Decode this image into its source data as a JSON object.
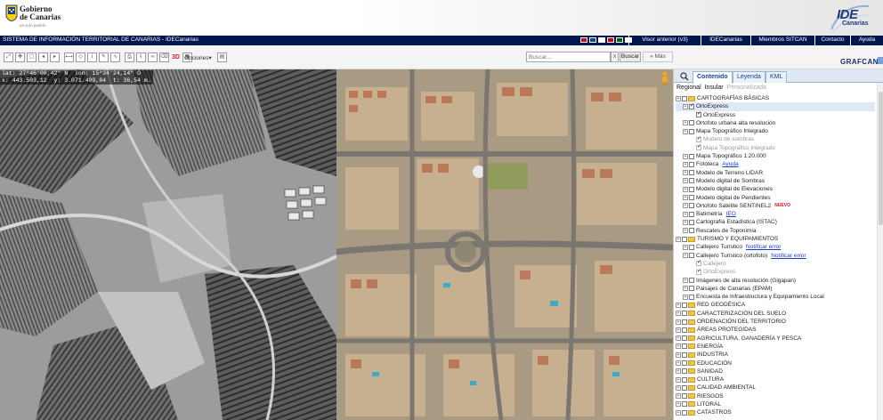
{
  "header": {
    "gov_line1": "Gobierno",
    "gov_line2": "de Canarias",
    "gov_tagline": "un solo pueblo",
    "ide_word": "IDE",
    "ide_sub": "Canarias"
  },
  "nav": {
    "system_title": "SISTEMA DE INFORMACIÓN TERRITORIAL DE CANARIAS - IDECanarias",
    "flags": [
      {
        "name": "flag-es",
        "color": "#c60b1e"
      },
      {
        "name": "flag-en",
        "color": "#1c3f94"
      },
      {
        "name": "flag-fr",
        "color": "#ffffff"
      },
      {
        "name": "flag-de",
        "color": "#dd0000"
      },
      {
        "name": "flag-pt",
        "color": "#006600"
      },
      {
        "name": "flag-it",
        "color": "#ffffff"
      }
    ],
    "links": [
      "Visor anterior (v3)",
      "IDECanarias",
      "Miembros SITCAN",
      "Contacto",
      "Ayuda"
    ]
  },
  "toolbar": {
    "tool_3d": "3D",
    "opciones_label": "Opciones",
    "search_placeholder": "Buscar...",
    "search_clear": "x",
    "search_button": "Buscar",
    "mas_button": "Más",
    "grafcan": "GRAFCAN"
  },
  "map": {
    "coords_line1": "lat: 27º46'00,42\" N  lon: 15º34'24,14\" O",
    "coords_line2": "x: 443.503,12  y: 3.071.499,84  t: 36,54 m."
  },
  "panel": {
    "tabs": [
      "Contenido",
      "Leyenda",
      "KML"
    ],
    "subtabs": [
      "Regional",
      "Insular",
      "Personalizada"
    ],
    "tree": [
      {
        "label": "CARTOGRAFÍAS BÁSICAS",
        "indent": 0,
        "plus": true,
        "type": "folder"
      },
      {
        "label": "OrtoExpress",
        "indent": 1,
        "plus": true,
        "type": "cb",
        "checked": true,
        "highlight": true
      },
      {
        "label": "OrtoExpress",
        "indent": 2,
        "plus": false,
        "type": "cb",
        "checked": true
      },
      {
        "label": "Ortofoto urbana alta resolución",
        "indent": 1,
        "plus": true,
        "type": "cb",
        "checked": false
      },
      {
        "label": "Mapa Topográfico Integrado",
        "indent": 1,
        "plus": true,
        "type": "cb",
        "checked": false
      },
      {
        "label": "Modelo de sombras",
        "indent": 2,
        "plus": false,
        "type": "cb",
        "checked": true,
        "grey": true
      },
      {
        "label": "Mapa Topográfico Integrado",
        "indent": 2,
        "plus": false,
        "type": "cb",
        "checked": true,
        "grey": true
      },
      {
        "label": "Mapa Topográfico 1:20.000",
        "indent": 1,
        "plus": true,
        "type": "cb",
        "checked": false
      },
      {
        "label": "Fototeca",
        "indent": 1,
        "plus": true,
        "type": "cb",
        "checked": false,
        "link": "Ayuda"
      },
      {
        "label": "Modelo de Terreno LIDAR",
        "indent": 1,
        "plus": true,
        "type": "cb",
        "checked": false
      },
      {
        "label": "Modelo digital de Sombras",
        "indent": 1,
        "plus": true,
        "type": "cb",
        "checked": false
      },
      {
        "label": "Modelo digital de Elevaciones",
        "indent": 1,
        "plus": true,
        "type": "cb",
        "checked": false
      },
      {
        "label": "Modelo digital de Pendientes",
        "indent": 1,
        "plus": true,
        "type": "cb",
        "checked": false
      },
      {
        "label": "Ortofoto Satélite SENTINEL2",
        "indent": 1,
        "plus": true,
        "type": "cb",
        "checked": false,
        "nuevo": "NUEVO"
      },
      {
        "label": "Batimetría",
        "indent": 1,
        "plus": true,
        "type": "cb",
        "checked": false,
        "link": "IEO"
      },
      {
        "label": "Cartografía Estadística (ISTAC)",
        "indent": 1,
        "plus": true,
        "type": "cb",
        "checked": false
      },
      {
        "label": "Rescates de Toponimia",
        "indent": 1,
        "plus": true,
        "type": "cb",
        "checked": false
      },
      {
        "label": "TURISMO Y EQUIPAMIENTOS",
        "indent": 0,
        "plus": true,
        "type": "folder"
      },
      {
        "label": "Callejero Turístico",
        "indent": 1,
        "plus": true,
        "type": "cb",
        "checked": false,
        "link": "Notificar error"
      },
      {
        "label": "Callejero Turístico (ortofoto)",
        "indent": 1,
        "plus": true,
        "type": "cb",
        "checked": false,
        "link": "Notificar error"
      },
      {
        "label": "Callejero",
        "indent": 2,
        "plus": false,
        "type": "cb",
        "checked": true,
        "grey": true
      },
      {
        "label": "OrtoExpress",
        "indent": 2,
        "plus": false,
        "type": "cb",
        "checked": true,
        "grey": true
      },
      {
        "label": "Imágenes de alta resolución (Gigapan)",
        "indent": 1,
        "plus": true,
        "type": "cb",
        "checked": false
      },
      {
        "label": "Paisajes de Canarias (EPAM)",
        "indent": 1,
        "plus": true,
        "type": "cb",
        "checked": false
      },
      {
        "label": "Encuesta de Infraestructura y Equipamiento Local",
        "indent": 1,
        "plus": true,
        "type": "cb",
        "checked": false
      },
      {
        "label": "RED GEODÉSICA",
        "indent": 0,
        "plus": true,
        "type": "folder"
      },
      {
        "label": "CARACTERIZACIÓN DEL SUELO",
        "indent": 0,
        "plus": true,
        "type": "folder"
      },
      {
        "label": "ORDENACIÓN DEL TERRITORIO",
        "indent": 0,
        "plus": true,
        "type": "folder"
      },
      {
        "label": "ÁREAS PROTEGIDAS",
        "indent": 0,
        "plus": true,
        "type": "folder"
      },
      {
        "label": "AGRICULTURA, GANADERÍA Y PESCA",
        "indent": 0,
        "plus": true,
        "type": "folder"
      },
      {
        "label": "ENERGÍA",
        "indent": 0,
        "plus": true,
        "type": "folder"
      },
      {
        "label": "INDUSTRIA",
        "indent": 0,
        "plus": true,
        "type": "folder"
      },
      {
        "label": "EDUCACIÓN",
        "indent": 0,
        "plus": true,
        "type": "folder"
      },
      {
        "label": "SANIDAD",
        "indent": 0,
        "plus": true,
        "type": "folder"
      },
      {
        "label": "CULTURA",
        "indent": 0,
        "plus": true,
        "type": "folder"
      },
      {
        "label": "CALIDAD AMBIENTAL",
        "indent": 0,
        "plus": true,
        "type": "folder"
      },
      {
        "label": "RIESGOS",
        "indent": 0,
        "plus": true,
        "type": "folder"
      },
      {
        "label": "LITORAL",
        "indent": 0,
        "plus": true,
        "type": "folder"
      },
      {
        "label": "CATASTROS",
        "indent": 0,
        "plus": true,
        "type": "folder"
      }
    ]
  }
}
